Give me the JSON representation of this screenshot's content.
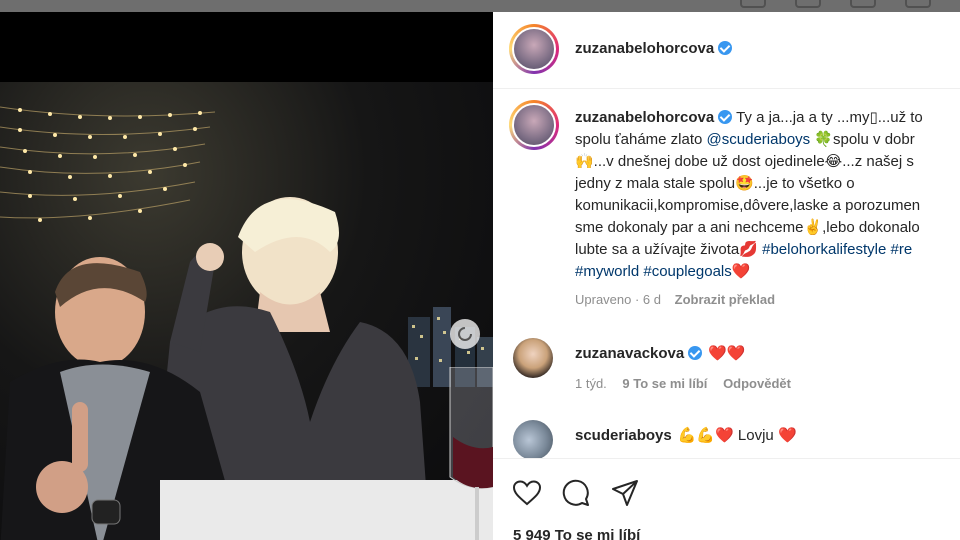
{
  "post": {
    "author": "zuzanabelohorcova",
    "caption": {
      "username": "zuzanabelohorcova",
      "line1": " Ty a ja...ja a ty ...my▯...už to",
      "line2_pre": "spolu ťaháme zlato ",
      "mention": "@scuderiaboys",
      "line2_post": " 🍀spolu v dobr",
      "line3": "🙌...v dnešnej dobe už dost ojedinele😂...z našej s",
      "line4": "jedny z mala stale spolu🤩...je to všetko o",
      "line5": "komunikacii,kompromise,dôvere,laske a porozumen",
      "line6": "sme dokonaly par a ani nechceme✌️,lebo dokonalo",
      "line7_pre": "lubte sa a užívajte života💋 ",
      "hashtag1": "#belohorkalifestyle",
      "hashtag2": "#re",
      "hashtag3": "#myworld",
      "hashtag4": "#couplegoals",
      "heart": "❤️"
    },
    "edited_label": "Upraveno · 6 d",
    "translate_label": "Zobrazit překlad",
    "likes_label": "5 949 To se mi líbí"
  },
  "comments": [
    {
      "username": "zuzanavackova",
      "text": "❤️❤️",
      "time": "1 týd.",
      "likes": "9 To se mi líbí",
      "reply": "Odpovědět"
    },
    {
      "username": "scuderiaboys",
      "text": "💪💪❤️ Lovju ❤️"
    }
  ],
  "icons": [
    "heart-icon",
    "comment-icon",
    "share-icon",
    "verified-icon"
  ],
  "colors": {
    "accent_link": "#00376b",
    "verified": "#3897f0",
    "muted": "#8e8e8e"
  }
}
